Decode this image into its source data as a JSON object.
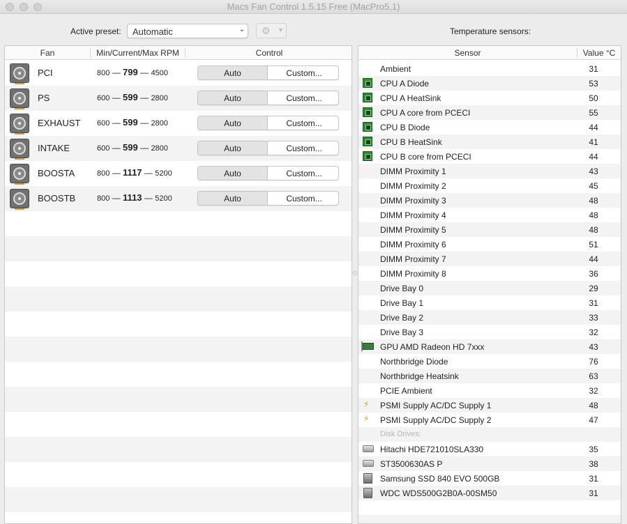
{
  "window": {
    "title": "Macs Fan Control 1.5.15 Free (MacPro5,1)"
  },
  "toolbar": {
    "preset_label": "Active preset:",
    "preset_value": "Automatic",
    "temp_label": "Temperature sensors:"
  },
  "fans": {
    "headers": {
      "fan": "Fan",
      "rpm": "Min/Current/Max RPM",
      "control": "Control"
    },
    "rows": [
      {
        "name": "PCI",
        "min": "800",
        "current": "799",
        "max": "4500",
        "auto": "Auto",
        "custom": "Custom..."
      },
      {
        "name": "PS",
        "min": "600",
        "current": "599",
        "max": "2800",
        "auto": "Auto",
        "custom": "Custom..."
      },
      {
        "name": "EXHAUST",
        "min": "600",
        "current": "599",
        "max": "2800",
        "auto": "Auto",
        "custom": "Custom..."
      },
      {
        "name": "INTAKE",
        "min": "600",
        "current": "599",
        "max": "2800",
        "auto": "Auto",
        "custom": "Custom..."
      },
      {
        "name": "BOOSTA",
        "min": "800",
        "current": "1117",
        "max": "5200",
        "auto": "Auto",
        "custom": "Custom..."
      },
      {
        "name": "BOOSTB",
        "min": "800",
        "current": "1113",
        "max": "5200",
        "auto": "Auto",
        "custom": "Custom..."
      }
    ],
    "separator": "—"
  },
  "sensors": {
    "headers": {
      "sensor": "Sensor",
      "value": "Value °C"
    },
    "rows": [
      {
        "name": "Ambient",
        "value": "31",
        "icon": "none"
      },
      {
        "name": "CPU A Diode",
        "value": "53",
        "icon": "cpu-icon"
      },
      {
        "name": "CPU A HeatSink",
        "value": "50",
        "icon": "cpu-icon"
      },
      {
        "name": "CPU A core from PCECI",
        "value": "55",
        "icon": "cpu-icon"
      },
      {
        "name": "CPU B Diode",
        "value": "44",
        "icon": "cpu-icon"
      },
      {
        "name": "CPU B HeatSink",
        "value": "41",
        "icon": "cpu-icon"
      },
      {
        "name": "CPU B core from PCECI",
        "value": "44",
        "icon": "cpu-icon"
      },
      {
        "name": "DIMM Proximity 1",
        "value": "43",
        "icon": "none"
      },
      {
        "name": "DIMM Proximity 2",
        "value": "45",
        "icon": "none"
      },
      {
        "name": "DIMM Proximity 3",
        "value": "48",
        "icon": "none"
      },
      {
        "name": "DIMM Proximity 4",
        "value": "48",
        "icon": "none"
      },
      {
        "name": "DIMM Proximity 5",
        "value": "48",
        "icon": "none"
      },
      {
        "name": "DIMM Proximity 6",
        "value": "51",
        "icon": "none"
      },
      {
        "name": "DIMM Proximity 7",
        "value": "44",
        "icon": "none"
      },
      {
        "name": "DIMM Proximity 8",
        "value": "36",
        "icon": "none"
      },
      {
        "name": "Drive Bay 0",
        "value": "29",
        "icon": "none"
      },
      {
        "name": "Drive Bay 1",
        "value": "31",
        "icon": "none"
      },
      {
        "name": "Drive Bay 2",
        "value": "33",
        "icon": "none"
      },
      {
        "name": "Drive Bay 3",
        "value": "32",
        "icon": "none"
      },
      {
        "name": "GPU AMD Radeon HD 7xxx",
        "value": "43",
        "icon": "gpu-icon"
      },
      {
        "name": "Northbridge Diode",
        "value": "76",
        "icon": "none"
      },
      {
        "name": "Northbridge Heatsink",
        "value": "63",
        "icon": "none"
      },
      {
        "name": "PCIE Ambient",
        "value": "32",
        "icon": "none"
      },
      {
        "name": "PSMI Supply AC/DC Supply 1",
        "value": "48",
        "icon": "power-icon"
      },
      {
        "name": "PSMI Supply AC/DC Supply 2",
        "value": "47",
        "icon": "power-icon"
      },
      {
        "name": "Disk Drives:",
        "value": "",
        "icon": "none",
        "heading": true
      },
      {
        "name": "Hitachi HDE721010SLA330",
        "value": "35",
        "icon": "hdd-icon"
      },
      {
        "name": "ST3500630AS P",
        "value": "38",
        "icon": "hdd-icon"
      },
      {
        "name": "Samsung SSD 840 EVO 500GB",
        "value": "31",
        "icon": "ssd-icon"
      },
      {
        "name": "WDC  WDS500G2B0A-00SM50",
        "value": "31",
        "icon": "ssd-icon"
      }
    ]
  }
}
